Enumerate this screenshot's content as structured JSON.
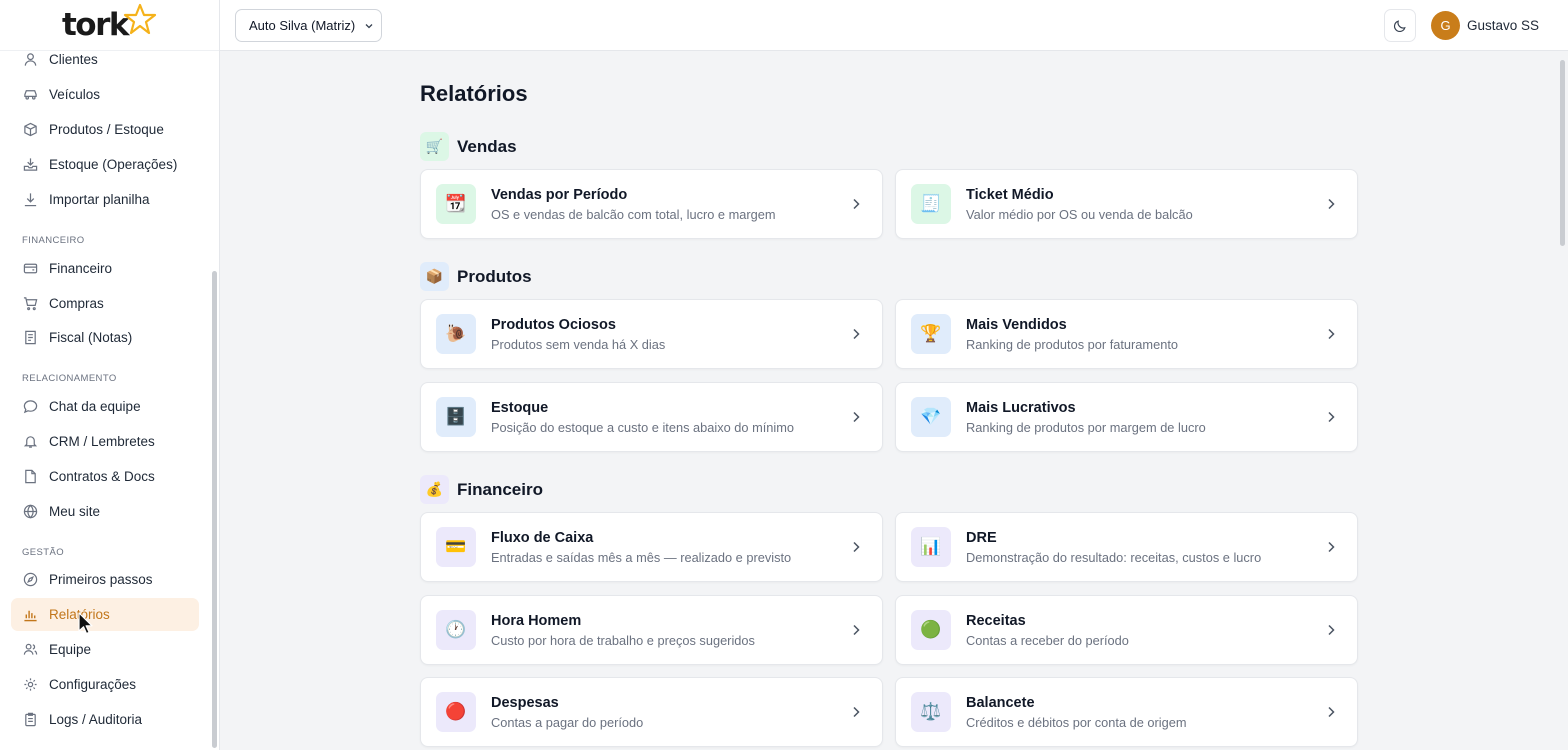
{
  "brand": {
    "logo_text": "tork"
  },
  "header": {
    "company_select": "Auto Silva (Matriz)",
    "user_initial": "G",
    "user_name": "Gustavo SS"
  },
  "sidebar": {
    "top_items": [
      {
        "label": "Clientes",
        "icon": "user-icon"
      },
      {
        "label": "Veículos",
        "icon": "car-icon"
      },
      {
        "label": "Produtos / Estoque",
        "icon": "box-icon"
      },
      {
        "label": "Estoque (Operações)",
        "icon": "inbox-download-icon"
      },
      {
        "label": "Importar planilha",
        "icon": "download-icon"
      }
    ],
    "section_financeiro": "FINANCEIRO",
    "financeiro_items": [
      {
        "label": "Financeiro",
        "icon": "wallet-icon"
      },
      {
        "label": "Compras",
        "icon": "cart-icon"
      },
      {
        "label": "Fiscal (Notas)",
        "icon": "receipt-icon"
      }
    ],
    "section_relacionamento": "RELACIONAMENTO",
    "relacionamento_items": [
      {
        "label": "Chat da equipe",
        "icon": "chat-icon"
      },
      {
        "label": "CRM / Lembretes",
        "icon": "bell-icon"
      },
      {
        "label": "Contratos & Docs",
        "icon": "document-icon"
      },
      {
        "label": "Meu site",
        "icon": "globe-icon"
      }
    ],
    "section_gestao": "GESTÃO",
    "gestao_items": [
      {
        "label": "Primeiros passos",
        "icon": "compass-icon"
      },
      {
        "label": "Relatórios",
        "icon": "bar-chart-icon",
        "active": true
      },
      {
        "label": "Equipe",
        "icon": "users-icon"
      },
      {
        "label": "Configurações",
        "icon": "gear-icon"
      },
      {
        "label": "Logs / Auditoria",
        "icon": "clipboard-icon"
      }
    ]
  },
  "main": {
    "title": "Relatórios",
    "sections": [
      {
        "title": "Vendas",
        "icon": "🛒",
        "cards": [
          {
            "title": "Vendas por Período",
            "subtitle": "OS e vendas de balcão com total, lucro e margem",
            "icon": "📆"
          },
          {
            "title": "Ticket Médio",
            "subtitle": "Valor médio por OS ou venda de balcão",
            "icon": "🧾"
          }
        ]
      },
      {
        "title": "Produtos",
        "icon": "📦",
        "cards": [
          {
            "title": "Produtos Ociosos",
            "subtitle": "Produtos sem venda há X dias",
            "icon": "🐌"
          },
          {
            "title": "Mais Vendidos",
            "subtitle": "Ranking de produtos por faturamento",
            "icon": "🏆"
          },
          {
            "title": "Estoque",
            "subtitle": "Posição do estoque a custo e itens abaixo do mínimo",
            "icon": "🗄️"
          },
          {
            "title": "Mais Lucrativos",
            "subtitle": "Ranking de produtos por margem de lucro",
            "icon": "💎"
          }
        ]
      },
      {
        "title": "Financeiro",
        "icon": "💰",
        "cards": [
          {
            "title": "Fluxo de Caixa",
            "subtitle": "Entradas e saídas mês a mês — realizado e previsto",
            "icon": "💳"
          },
          {
            "title": "DRE",
            "subtitle": "Demonstração do resultado: receitas, custos e lucro",
            "icon": "📊"
          },
          {
            "title": "Hora Homem",
            "subtitle": "Custo por hora de trabalho e preços sugeridos",
            "icon": "🕐"
          },
          {
            "title": "Receitas",
            "subtitle": "Contas a receber do período",
            "icon": "🟢"
          },
          {
            "title": "Despesas",
            "subtitle": "Contas a pagar do período",
            "icon": "🔴"
          },
          {
            "title": "Balancete",
            "subtitle": "Créditos e débitos por conta de origem",
            "icon": "⚖️"
          }
        ]
      }
    ]
  },
  "colors": {
    "accent": "#c2761a",
    "active_bg": "#fdf0e3",
    "avatar": "#c97d1a",
    "star": "#f5b21b",
    "vendas_bg": "#dcf7e6",
    "produtos_bg": "#e0ecfb",
    "financeiro_bg": "#ece9fb"
  }
}
